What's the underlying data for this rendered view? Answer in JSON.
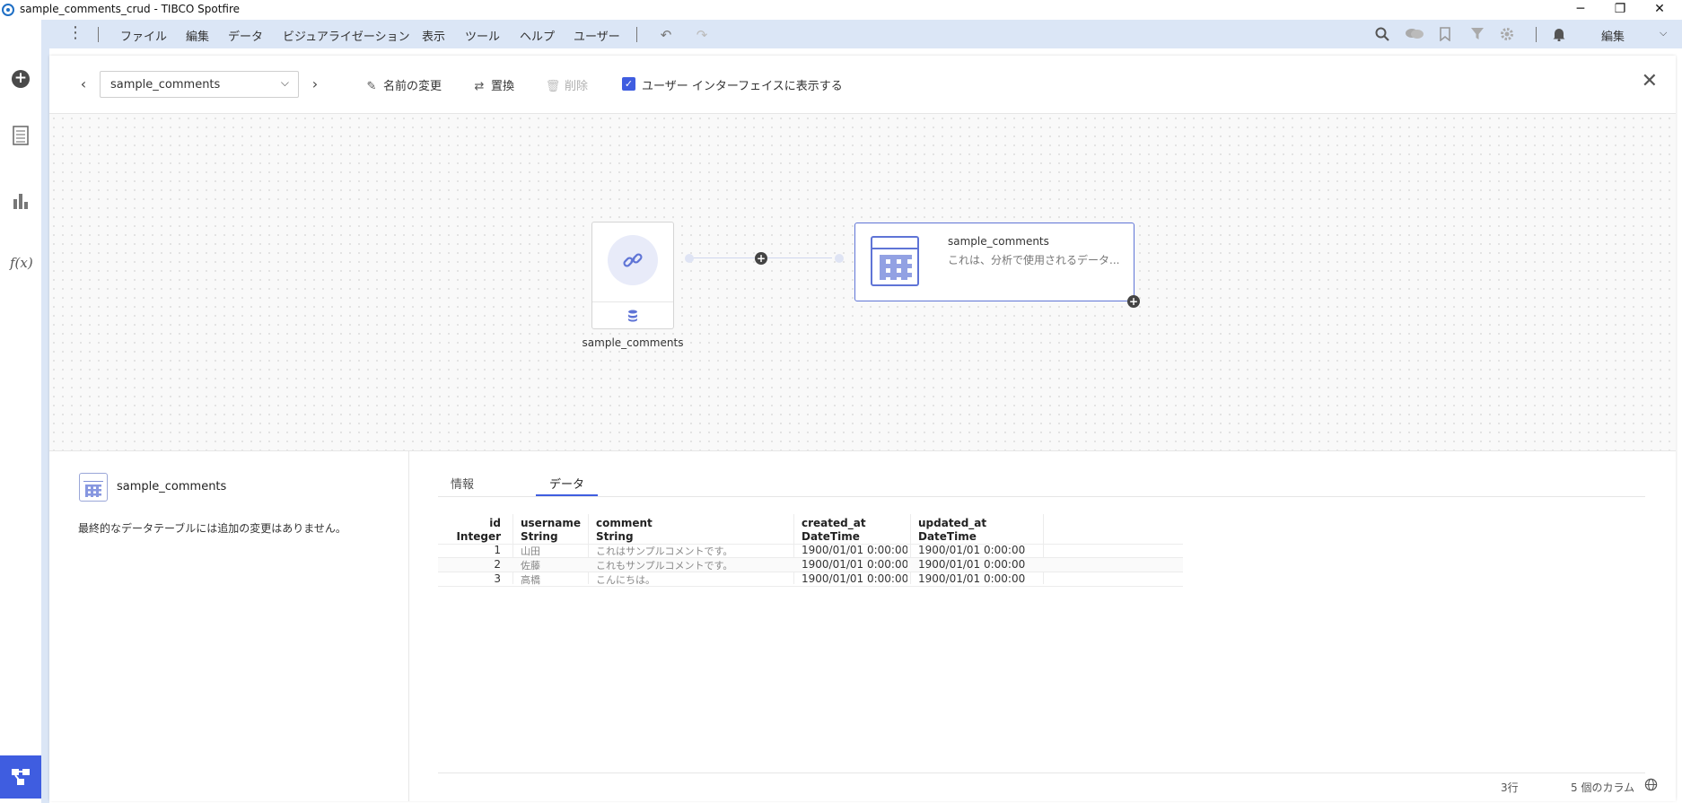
{
  "window": {
    "title": "sample_comments_crud - TIBCO Spotfire",
    "controls": {
      "minimize": "─",
      "restore": "❐",
      "close": "✕"
    }
  },
  "rail": {
    "items": [
      {
        "name": "add",
        "icon": "plus-circle-icon",
        "glyph": "+"
      },
      {
        "name": "data",
        "icon": "table-list-icon",
        "glyph": "▤"
      },
      {
        "name": "visualizations",
        "icon": "bar-chart-icon",
        "glyph": "▮"
      },
      {
        "name": "expressions",
        "icon": "fx-icon",
        "glyph": "f(x)"
      },
      {
        "name": "data-canvas",
        "icon": "data-flow-icon",
        "glyph": "⧉"
      }
    ]
  },
  "menubar": {
    "items": [
      "ファイル",
      "編集",
      "データ",
      "ビジュアライゼーション",
      "表示",
      "ツール",
      "ヘルプ",
      "ユーザー"
    ],
    "mode": "編集"
  },
  "toolbar": {
    "table_select": "sample_comments",
    "rename": "名前の変更",
    "replace": "置換",
    "delete": "削除",
    "show_in_ui": "ユーザー インターフェイスに表示する"
  },
  "canvas": {
    "source_node_label": "sample_comments",
    "dest_node_name": "sample_comments",
    "dest_node_desc": "これは、分析で使用されるデータ..."
  },
  "details": {
    "table_name": "sample_comments",
    "message": "最終的なデータテーブルには追加の変更はありません。",
    "tabs": [
      "情報",
      "データ"
    ],
    "active_tab": "データ",
    "columns": [
      {
        "name": "id",
        "type": "Integer"
      },
      {
        "name": "username",
        "type": "String"
      },
      {
        "name": "comment",
        "type": "String"
      },
      {
        "name": "created_at",
        "type": "DateTime"
      },
      {
        "name": "updated_at",
        "type": "DateTime"
      }
    ],
    "rows": [
      [
        "1",
        "山田",
        "これはサンプルコメントです。",
        "1900/01/01 0:00:00",
        "1900/01/01 0:00:00"
      ],
      [
        "2",
        "佐藤",
        "これもサンプルコメントです。",
        "1900/01/01 0:00:00",
        "1900/01/01 0:00:00"
      ],
      [
        "3",
        "高橋",
        "こんにちは。",
        "1900/01/01 0:00:00",
        "1900/01/01 0:00:00"
      ]
    ],
    "row_count": "3行",
    "column_count": "5 個のカラム"
  },
  "colors": {
    "accent": "#3f5de0",
    "menubar_bg": "#dbe6f6",
    "node_blue": "#5f74d6"
  }
}
